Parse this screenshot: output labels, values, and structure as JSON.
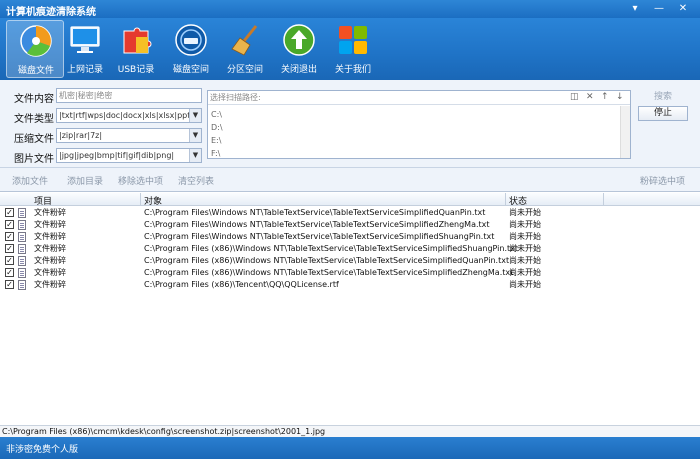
{
  "window": {
    "title": "计算机痕迹清除系统",
    "controls": [
      "▾",
      "—",
      "✕"
    ]
  },
  "toolbar": {
    "items": [
      {
        "label": "磁盘文件",
        "icon": "disk-pie-icon",
        "active": true
      },
      {
        "label": "上网记录",
        "icon": "monitor-icon",
        "active": false
      },
      {
        "label": "USB记录",
        "icon": "usb-puzzle-icon",
        "active": false
      },
      {
        "label": "磁盘空间",
        "icon": "hard-drive-icon",
        "active": false
      },
      {
        "label": "分区空间",
        "icon": "broom-icon",
        "active": false
      },
      {
        "label": "关闭退出",
        "icon": "exit-arrow-icon",
        "active": false
      },
      {
        "label": "关于我们",
        "icon": "windows-logo-icon",
        "active": false
      }
    ]
  },
  "form": {
    "content_label": "文件内容",
    "content_placeholder": "机密|秘密|绝密",
    "type_label": "文件类型",
    "type_value": "|txt|rtf|wps|doc|docx|xls|xlsx|ppt...",
    "zip_label": "压缩文件",
    "zip_value": "|zip|rar|7z|",
    "image_label": "图片文件",
    "image_value": "|jpg|jpeg|bmp|tif|gif|dib|png|"
  },
  "scan": {
    "placeholder": "选择扫描路径:",
    "paths": [
      "C:\\",
      "D:\\",
      "E:\\",
      "F:\\"
    ],
    "search_label": "搜索",
    "stop_label": "停止"
  },
  "actions": {
    "add_file": "添加文件",
    "add_dir": "添加目录",
    "remove_selected": "移除选中项",
    "clear_list": "清空列表",
    "shred_selected": "粉碎选中项"
  },
  "table": {
    "columns": [
      "项目",
      "对象",
      "状态"
    ],
    "rows": [
      {
        "item": "文件粉碎",
        "object": "C:\\Program Files\\Windows NT\\TableTextService\\TableTextServiceSimplifiedQuanPin.txt",
        "status": "尚未开始"
      },
      {
        "item": "文件粉碎",
        "object": "C:\\Program Files\\Windows NT\\TableTextService\\TableTextServiceSimplifiedZhengMa.txt",
        "status": "尚未开始"
      },
      {
        "item": "文件粉碎",
        "object": "C:\\Program Files\\Windows NT\\TableTextService\\TableTextServiceSimplifiedShuangPin.txt",
        "status": "尚未开始"
      },
      {
        "item": "文件粉碎",
        "object": "C:\\Program Files (x86)\\Windows NT\\TableTextService\\TableTextServiceSimplifiedShuangPin.txt",
        "status": "尚未开始"
      },
      {
        "item": "文件粉碎",
        "object": "C:\\Program Files (x86)\\Windows NT\\TableTextService\\TableTextServiceSimplifiedQuanPin.txt",
        "status": "尚未开始"
      },
      {
        "item": "文件粉碎",
        "object": "C:\\Program Files (x86)\\Windows NT\\TableTextService\\TableTextServiceSimplifiedZhengMa.txt",
        "status": "尚未开始"
      },
      {
        "item": "文件粉碎",
        "object": "C:\\Program Files (x86)\\Tencent\\QQ\\QQLicense.rtf",
        "status": "尚未开始"
      }
    ]
  },
  "status_path": "C:\\Program Files (x86)\\cmcm\\kdesk\\config\\screenshot.zip|screenshot\\2001_1.jpg",
  "footer_text": "非涉密免费个人版",
  "colors": {
    "accent": "#1f73c6",
    "chrome": "#2a84d8",
    "panel": "#eef3fa"
  }
}
